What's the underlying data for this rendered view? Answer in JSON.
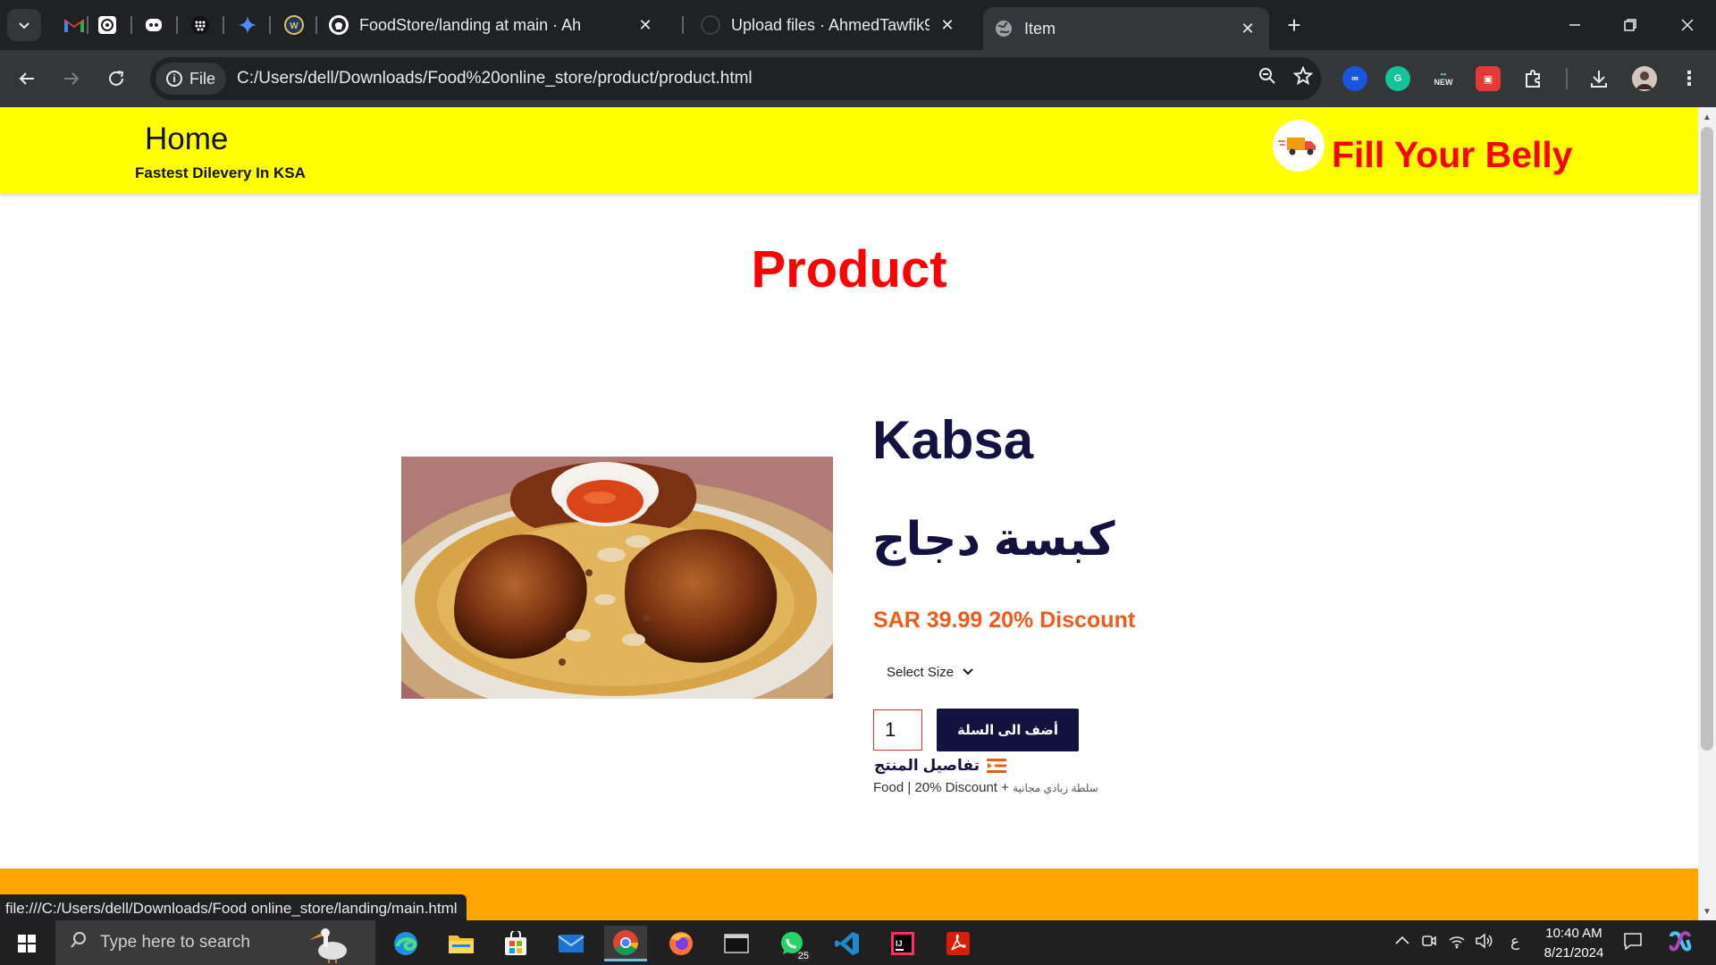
{
  "browser": {
    "tabs": [
      {
        "title": "FoodStore/landing at main · Ah",
        "close": "✕"
      },
      {
        "title": "Upload files · AhmedTawfik98/F",
        "close": "✕"
      },
      {
        "title": "Item",
        "close": "✕"
      }
    ],
    "new_tab": "+",
    "scheme_chip": "File",
    "url": "C:/Users/dell/Downloads/Food%20online_store/product/product.html",
    "status_link": "file:///C:/Users/dell/Downloads/Food online_store/landing/main.html",
    "ext_new_label": "NEW"
  },
  "site": {
    "home": "Home",
    "tagline": "Fastest Dilevery In KSA",
    "brand": "Fill Your Belly"
  },
  "page": {
    "title": "Product"
  },
  "product": {
    "name": "Kabsa",
    "name_ar": "كبسة دجاج",
    "price": "SAR 39.99 20% Discount",
    "size_select": "Select Size",
    "quantity": "1",
    "add_to_cart": "أضف الى السلة",
    "details_title": "تفاصيل المنتج",
    "details_text": "Food | 20% Discount + ",
    "details_text_ar": "سلطة زبادي مجانية"
  },
  "taskbar": {
    "search_placeholder": "Type here to search",
    "whatsapp_badge": "25",
    "tray_lang": "ع",
    "time": "10:40 AM",
    "date": "8/21/2024"
  },
  "colors": {
    "header_bg": "#ffff00",
    "brand_red": "#ff0000",
    "navy": "#14123f",
    "price_orange": "#f05a1a",
    "footer_orange": "#ffa500"
  }
}
